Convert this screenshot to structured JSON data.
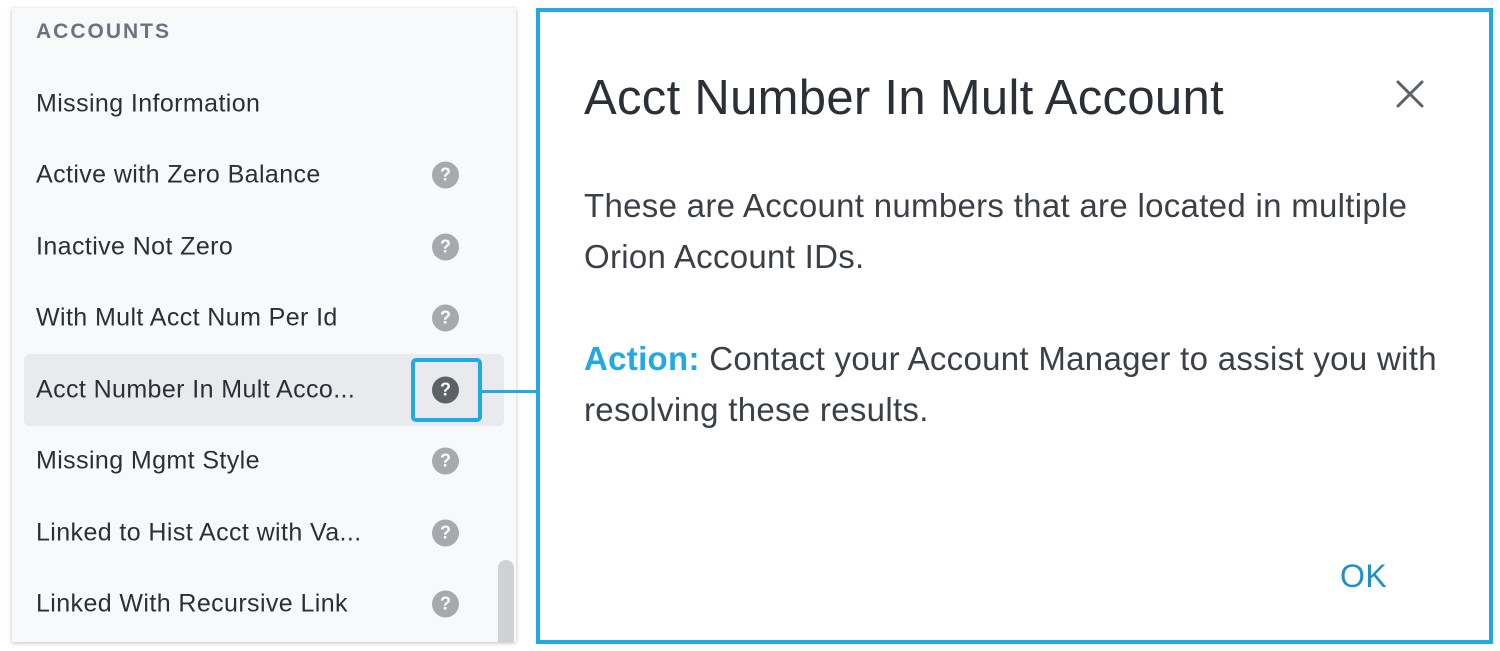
{
  "sidebar": {
    "section_header": "ACCOUNTS",
    "items": [
      {
        "label": "Missing Information",
        "has_help": false
      },
      {
        "label": "Active with Zero Balance",
        "has_help": true
      },
      {
        "label": "Inactive Not Zero",
        "has_help": true
      },
      {
        "label": "With Mult Acct Num Per Id",
        "has_help": true
      },
      {
        "label": "Acct Number In Mult Acco...",
        "has_help": true,
        "selected": true
      },
      {
        "label": "Missing Mgmt Style",
        "has_help": true
      },
      {
        "label": "Linked to Hist Acct with Va...",
        "has_help": true
      },
      {
        "label": "Linked With Recursive Link",
        "has_help": true
      }
    ],
    "help_icon_glyph": "?"
  },
  "dialog": {
    "title": "Acct Number In Mult Account",
    "close_icon": "close-icon",
    "body": "These are Account numbers that are located in multiple Orion Account IDs.",
    "action_label": "Action:",
    "action_text": " Contact your Account Manager to assist you with resolving these results.",
    "ok_label": "OK"
  },
  "colors": {
    "accent": "#23a9e1",
    "link": "#1e8fd0",
    "text": "#2b2f36",
    "help_icon": "#a7a9ae",
    "help_icon_active": "#5d6168"
  }
}
